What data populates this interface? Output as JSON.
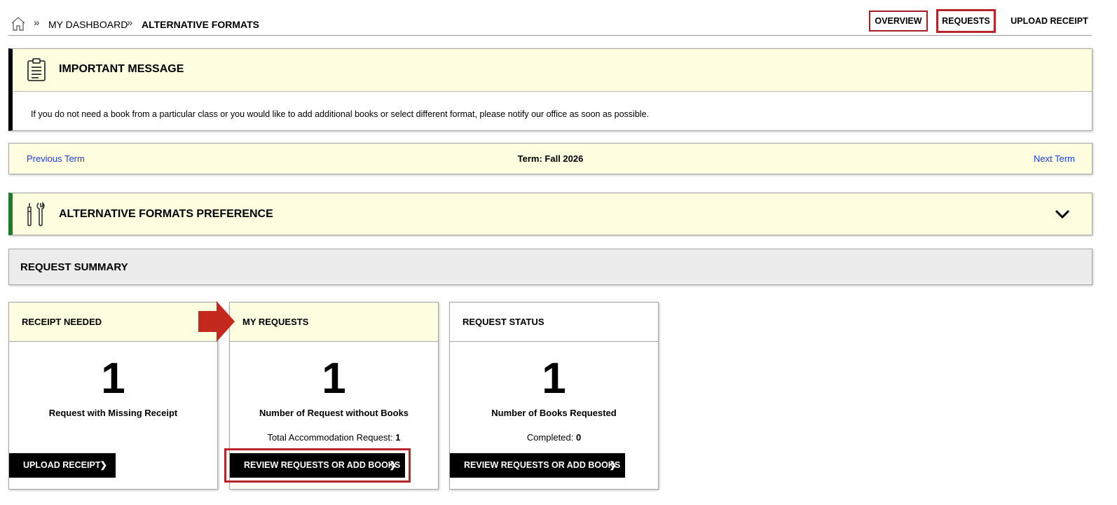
{
  "breadcrumb": {
    "items": [
      "MY DASHBOARD",
      "ALTERNATIVE FORMATS"
    ],
    "separator": "»"
  },
  "nav": {
    "overview": "OVERVIEW",
    "requests": "REQUESTS",
    "upload_receipt": "UPLOAD RECEIPT"
  },
  "important_message": {
    "title": "IMPORTANT MESSAGE",
    "body": "If you do not need a book from a particular class or you would like to add additional books or select different format, please notify our office as soon as possible."
  },
  "term": {
    "previous": "Previous Term",
    "current": "Term: Fall 2026",
    "next": "Next Term"
  },
  "preference": {
    "title": "ALTERNATIVE FORMATS PREFERENCE"
  },
  "summary": {
    "title": "REQUEST SUMMARY"
  },
  "cards": [
    {
      "title": "RECEIPT NEEDED",
      "count": "1",
      "caption": "Request with Missing Receipt",
      "sub_label": "",
      "sub_value": "",
      "button": "UPLOAD RECEIPT"
    },
    {
      "title": "MY REQUESTS",
      "count": "1",
      "caption": "Number of Request without Books",
      "sub_label": "Total Accommodation Request:",
      "sub_value": "1",
      "button": "REVIEW REQUESTS OR ADD BOOKS"
    },
    {
      "title": "REQUEST STATUS",
      "count": "1",
      "caption": "Number of Books Requested",
      "sub_label": "Completed:",
      "sub_value": "0",
      "button": "REVIEW REQUESTS OR ADD BOOKS"
    }
  ],
  "colors": {
    "highlight": "#b5252a",
    "panel_yellow": "#fefde0",
    "link_blue": "#1a3ed8",
    "preference_accent": "#1e7a2b"
  },
  "icons": {
    "home": "home-icon",
    "message": "clipboard-icon",
    "preference": "tools-icon",
    "expand": "chevron-down-icon",
    "button": "chevron-right-icon"
  }
}
